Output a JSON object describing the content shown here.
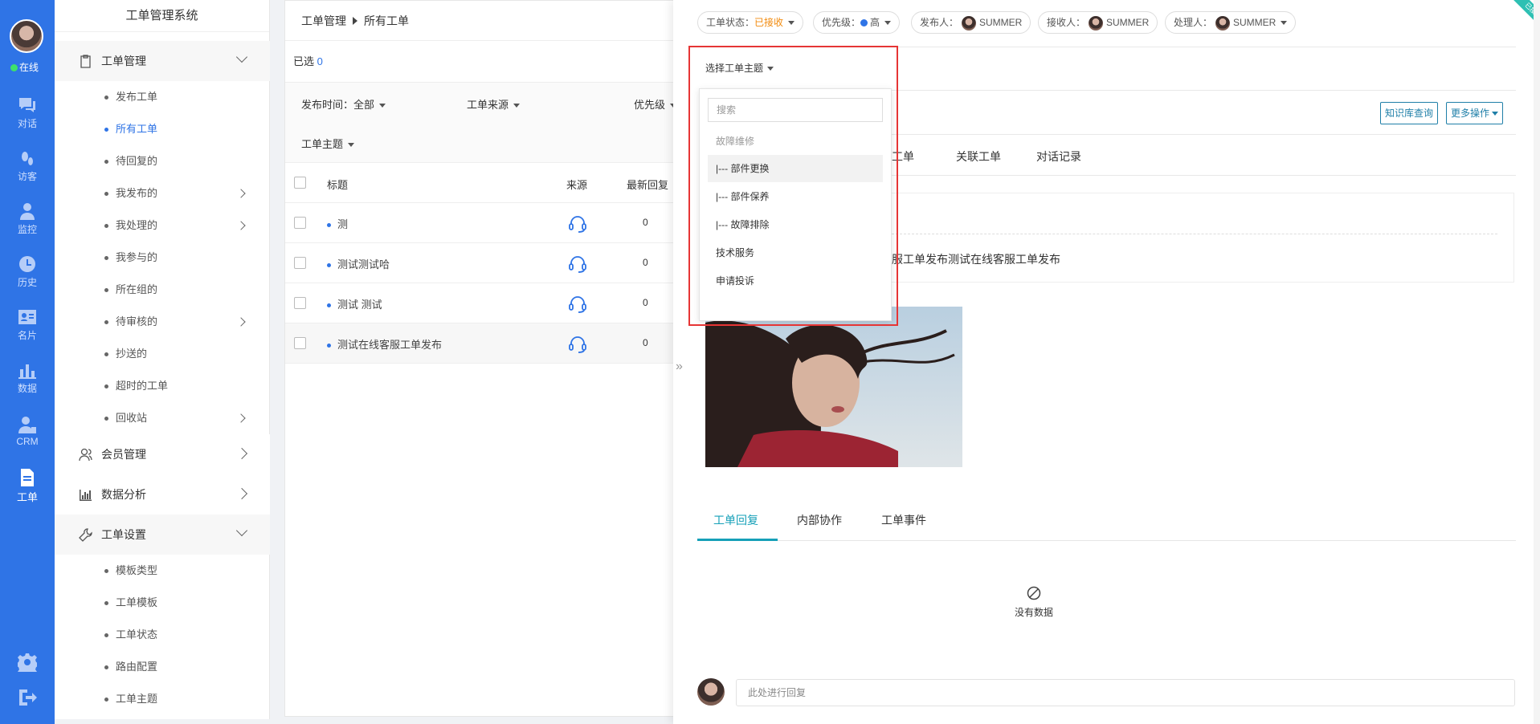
{
  "rail": {
    "status": "在线",
    "items": [
      {
        "label": "对话",
        "icon": "chat-icon"
      },
      {
        "label": "访客",
        "icon": "footprint-icon"
      },
      {
        "label": "监控",
        "icon": "monitor-user-icon"
      },
      {
        "label": "历史",
        "icon": "clock-icon"
      },
      {
        "label": "名片",
        "icon": "card-icon"
      },
      {
        "label": "数据",
        "icon": "bar-chart-icon"
      },
      {
        "label": "CRM",
        "icon": "crm-user-icon"
      },
      {
        "label": "工单",
        "icon": "document-icon"
      }
    ]
  },
  "sidebar": {
    "title": "工单管理系统",
    "groups": [
      {
        "label": "工单管理",
        "icon": "clipboard-icon"
      },
      {
        "label": "会员管理",
        "icon": "members-icon"
      },
      {
        "label": "数据分析",
        "icon": "analytics-icon"
      },
      {
        "label": "工单设置",
        "icon": "wrench-icon"
      }
    ],
    "ticket_items": [
      "发布工单",
      "所有工单",
      "待回复的",
      "我发布的",
      "我处理的",
      "我参与的",
      "所在组的",
      "待审核的",
      "抄送的",
      "超时的工单",
      "回收站"
    ],
    "settings_items": [
      "模板类型",
      "工单模板",
      "工单状态",
      "路由配置",
      "工单主题"
    ]
  },
  "list": {
    "breadcrumb_root": "工单管理",
    "breadcrumb_current": "所有工单",
    "selected_label": "已选",
    "selected_count": "0",
    "filters": {
      "time": "发布时间：全部",
      "source": "工单来源",
      "priority": "优先级",
      "topic": "工单主题"
    },
    "columns": {
      "title": "标题",
      "source": "来源",
      "latest": "最新回复"
    },
    "rows": [
      {
        "title": "测",
        "latest": "0"
      },
      {
        "title": "测试测试哈",
        "latest": "0"
      },
      {
        "title": "测试 测试",
        "latest": "0"
      },
      {
        "title": "测试在线客服工单发布",
        "latest": "0"
      }
    ]
  },
  "detail": {
    "corner_badge": "已接",
    "status_label": "工单状态：",
    "status_value": "已接收",
    "priority_label": "优先级：",
    "priority_value": "高",
    "publisher_label": "发布人：",
    "publisher_name": "SUMMER",
    "receiver_label": "接收人：",
    "receiver_name": "SUMMER",
    "handler_label": "处理人：",
    "handler_name": "SUMMER",
    "topic_select": "选择工单主题",
    "dropdown": {
      "search_placeholder": "搜索",
      "options": [
        "故障维修",
        "|--- 部件更换",
        "|--- 部件保养",
        "|--- 故障排除",
        "技术服务",
        "申请投诉"
      ]
    },
    "kb_button": "知识库查询",
    "more_button": "更多操作",
    "tabs": [
      "工单",
      "关联工单",
      "对话记录"
    ],
    "content_text": "服工单发布测试在线客服工单发布",
    "bottom_tabs": [
      "工单回复",
      "内部协作",
      "工单事件"
    ],
    "no_data": "没有数据",
    "reply_placeholder": "此处进行回复"
  }
}
